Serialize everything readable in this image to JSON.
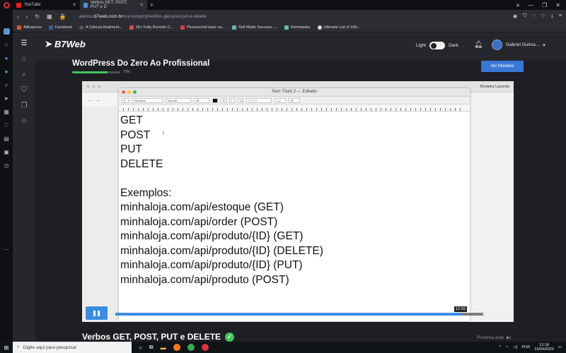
{
  "browser": {
    "tabs": [
      {
        "label": "YouTube",
        "active": false
      },
      {
        "label": "Verbos GET, POST, PUT e D",
        "active": true
      }
    ],
    "url_prefix": "alunos.",
    "url_domain": "b7web.com.br",
    "url_path": "/curso/wpzp/verbos-get-post-put-e-delete",
    "bookmarks": [
      "AliExpress",
      "Facebook",
      "A Ciência finalment...",
      "25+ Fully Remote C...",
      "Picosecond laser ca...",
      "Self Made Success -...",
      "Remotasks",
      "Ultimate List of 100..."
    ]
  },
  "header": {
    "logo": "B7Web",
    "theme_light": "Light",
    "theme_dark": "Dark",
    "user_name": "Gabriel Guima..."
  },
  "course": {
    "title": "WordPress Do Zero Ao Profissional",
    "progress_label": "73%",
    "progress": 0.73,
    "modules_button": "Ver Módulos"
  },
  "video": {
    "presenter": "Bonieky Lacerda",
    "doc_title": "Sem Título 2 — Editado",
    "lines": [
      "GET",
      "POST",
      "PUT",
      "DELETE",
      "",
      "Exemplos:",
      "minhaloja.com/api/estoque (GET)",
      "minhaloja.com/api/order (POST)",
      "minhaloja.com/api/produto/{ID} (GET)",
      "minhaloja.com/api/produto/{ID} (DELETE)",
      "minhaloja.com/api/produto/{ID} (PUT)",
      "minhaloja.com/api/produto (POST)"
    ],
    "font_box": "Helvetica",
    "style_box": "Normal",
    "size_box": "36",
    "spacing_box": "1,0",
    "time": "12:28",
    "played": 0.94
  },
  "lesson": {
    "title": "Verbos GET, POST, PUT e DELETE",
    "next": "Próxima aula"
  },
  "taskbar": {
    "search_placeholder": "Digite aqui para pesquisar",
    "lang": "POR",
    "time": "12:18",
    "date": "15/04/2020"
  },
  "colors": {
    "accent": "#3a8de0",
    "progress": "#3fc55b",
    "background": "#1e1f24"
  }
}
